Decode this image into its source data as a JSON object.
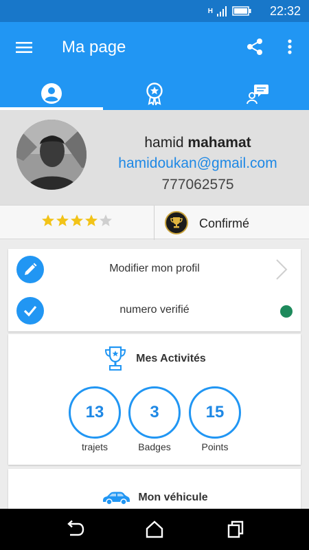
{
  "status_bar": {
    "time": "22:32",
    "network": "H"
  },
  "app_bar": {
    "title": "Ma page",
    "tabs": [
      {
        "icon": "account-circle-icon",
        "active": true
      },
      {
        "icon": "award-badge-icon",
        "active": false
      },
      {
        "icon": "chat-user-icon",
        "active": false
      }
    ]
  },
  "profile": {
    "first_name": "hamid",
    "last_name": "mahamat",
    "email": "hamidoukan@gmail.com",
    "phone": "777062575"
  },
  "rating": {
    "stars_filled": 4,
    "stars_total": 5,
    "level_label": "Confirmé"
  },
  "actions": {
    "edit_label": "Modifier mon profil",
    "verified_label": "numero verifié"
  },
  "activities": {
    "title": "Mes Activités",
    "stats": [
      {
        "value": "13",
        "label": "trajets"
      },
      {
        "value": "3",
        "label": "Badges"
      },
      {
        "value": "15",
        "label": "Points"
      }
    ]
  },
  "vehicle": {
    "title": "Mon véhicule"
  },
  "colors": {
    "primary": "#2196f3",
    "status_bar": "#1877c9",
    "star": "#f2c318",
    "verified_dot": "#1e8a5c"
  }
}
